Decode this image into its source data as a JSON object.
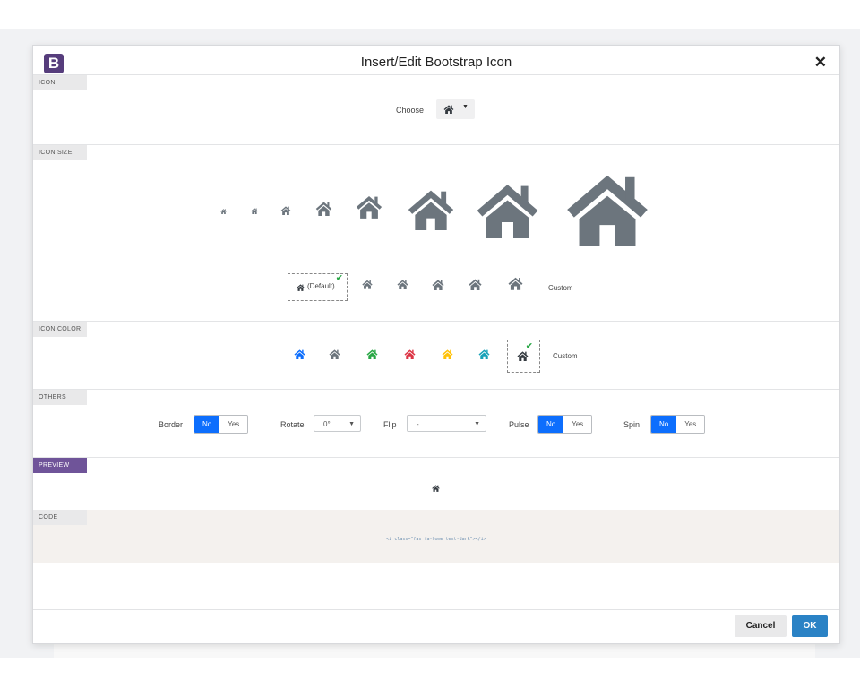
{
  "dialog": {
    "logo_letter": "B",
    "title": "Insert/Edit Bootstrap Icon",
    "close_glyph": "✕"
  },
  "sections": {
    "icon": "ICON",
    "icon_size": "ICON SIZE",
    "icon_color": "ICON COLOR",
    "others": "OTHERS",
    "preview": "PREVIEW",
    "code": "CODE"
  },
  "icon": {
    "choose_label": "Choose",
    "current_icon": "home-icon"
  },
  "size": {
    "default_label": "(Default)",
    "custom_label": "Custom",
    "selected": "default"
  },
  "color": {
    "swatches": [
      {
        "name": "primary",
        "hex": "#0d6efd"
      },
      {
        "name": "secondary",
        "hex": "#6c757d"
      },
      {
        "name": "success",
        "hex": "#28a745"
      },
      {
        "name": "danger",
        "hex": "#dc3545"
      },
      {
        "name": "warning",
        "hex": "#ffc107"
      },
      {
        "name": "info",
        "hex": "#17a2b8"
      },
      {
        "name": "dark",
        "hex": "#343a40"
      }
    ],
    "selected": "dark",
    "custom_label": "Custom"
  },
  "others": {
    "border_label": "Border",
    "border_no": "No",
    "border_yes": "Yes",
    "rotate_label": "Rotate",
    "rotate_value": "0°",
    "flip_label": "Flip",
    "flip_value": "-",
    "pulse_label": "Pulse",
    "pulse_no": "No",
    "pulse_yes": "Yes",
    "spin_label": "Spin",
    "spin_no": "No",
    "spin_yes": "Yes"
  },
  "code": {
    "snippet": "<i class=\"fas fa-home text-dark\"></i>"
  },
  "footer": {
    "cancel": "Cancel",
    "ok": "OK"
  },
  "colors": {
    "accent": "#0d6efd",
    "icon_gray": "#6c757d",
    "brand": "#563d7c",
    "ok_button": "#2a82c5",
    "code_bg": "#f4f1ee"
  }
}
